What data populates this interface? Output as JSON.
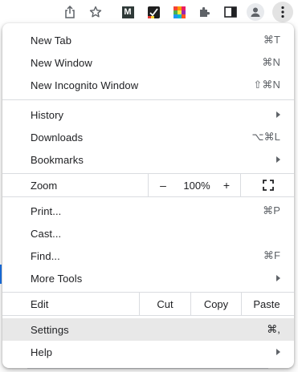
{
  "toolbar": {
    "icons": [
      "share-icon",
      "bookmark-star-icon",
      "extension-m-icon",
      "extension-checkmark-icon",
      "extension-color-grid-icon",
      "extensions-puzzle-icon",
      "side-panel-icon",
      "profile-avatar-icon",
      "menu-kebab-icon"
    ],
    "extension_m_letter": "M"
  },
  "menu": {
    "group1": [
      {
        "label": "New Tab",
        "shortcut": "⌘T"
      },
      {
        "label": "New Window",
        "shortcut": "⌘N"
      },
      {
        "label": "New Incognito Window",
        "shortcut": "⇧⌘N"
      }
    ],
    "group2": [
      {
        "label": "History",
        "submenu": true
      },
      {
        "label": "Downloads",
        "shortcut": "⌥⌘L"
      },
      {
        "label": "Bookmarks",
        "submenu": true
      }
    ],
    "zoom": {
      "label": "Zoom",
      "minus": "–",
      "value": "100%",
      "plus": "+"
    },
    "group3": [
      {
        "label": "Print...",
        "shortcut": "⌘P"
      },
      {
        "label": "Cast..."
      },
      {
        "label": "Find...",
        "shortcut": "⌘F"
      },
      {
        "label": "More Tools",
        "submenu": true
      }
    ],
    "edit": {
      "label": "Edit",
      "cut": "Cut",
      "copy": "Copy",
      "paste": "Paste"
    },
    "group4": [
      {
        "label": "Settings",
        "shortcut": "⌘,",
        "highlighted": true
      },
      {
        "label": "Help",
        "submenu": true
      }
    ]
  },
  "colors": {
    "highlight": "#e8e8e8",
    "separator": "#dadce0",
    "text": "#202124",
    "shortcut": "#5f6368"
  }
}
